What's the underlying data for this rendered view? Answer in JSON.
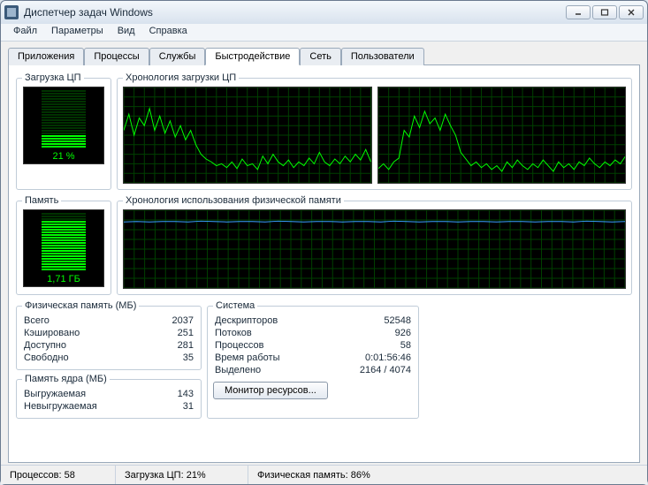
{
  "window": {
    "title": "Диспетчер задач Windows"
  },
  "menu": {
    "file": "Файл",
    "options": "Параметры",
    "view": "Вид",
    "help": "Справка"
  },
  "tabs": {
    "applications": "Приложения",
    "processes": "Процессы",
    "services": "Службы",
    "performance": "Быстродействие",
    "networking": "Сеть",
    "users": "Пользователи"
  },
  "perf": {
    "cpu_group": "Загрузка ЦП",
    "cpu_history_group": "Хронология загрузки ЦП",
    "mem_group": "Память",
    "mem_history_group": "Хронология использования физической памяти",
    "cpu_value": "21 %",
    "mem_value": "1,71 ГБ"
  },
  "phys_mem": {
    "title": "Физическая память (МБ)",
    "total_k": "Всего",
    "total_v": "2037",
    "cached_k": "Кэшировано",
    "cached_v": "251",
    "avail_k": "Доступно",
    "avail_v": "281",
    "free_k": "Свободно",
    "free_v": "35"
  },
  "kernel_mem": {
    "title": "Память ядра (МБ)",
    "paged_k": "Выгружаемая",
    "paged_v": "143",
    "nonpaged_k": "Невыгружаемая",
    "nonpaged_v": "31"
  },
  "system": {
    "title": "Система",
    "handles_k": "Дескрипторов",
    "handles_v": "52548",
    "threads_k": "Потоков",
    "threads_v": "926",
    "procs_k": "Процессов",
    "procs_v": "58",
    "uptime_k": "Время работы",
    "uptime_v": "0:01:56:46",
    "commit_k": "Выделено",
    "commit_v": "2164 / 4074"
  },
  "buttons": {
    "resmon": "Монитор ресурсов..."
  },
  "status": {
    "procs": "Процессов: 58",
    "cpu": "Загрузка ЦП: 21%",
    "mem": "Физическая память: 86%"
  },
  "chart_data": [
    {
      "type": "line",
      "title": "Хронология загрузки ЦП (ядро 1)",
      "x": "time",
      "xlabel": "",
      "ylabel": "%",
      "ylim": [
        0,
        100
      ],
      "values": [
        55,
        72,
        50,
        68,
        60,
        78,
        55,
        70,
        52,
        65,
        48,
        60,
        45,
        55,
        40,
        30,
        25,
        22,
        18,
        20,
        16,
        22,
        15,
        25,
        18,
        20,
        14,
        28,
        20,
        30,
        22,
        18,
        24,
        16,
        22,
        18,
        26,
        20,
        32,
        22,
        18,
        25,
        20,
        28,
        22,
        30,
        24,
        35,
        22
      ]
    },
    {
      "type": "line",
      "title": "Хронология загрузки ЦП (ядро 2)",
      "x": "time",
      "xlabel": "",
      "ylabel": "%",
      "ylim": [
        0,
        100
      ],
      "values": [
        15,
        20,
        14,
        22,
        26,
        55,
        48,
        70,
        58,
        75,
        62,
        68,
        55,
        72,
        60,
        50,
        32,
        25,
        18,
        22,
        16,
        20,
        14,
        18,
        12,
        22,
        16,
        24,
        18,
        14,
        20,
        16,
        24,
        18,
        12,
        22,
        16,
        20,
        14,
        22,
        18,
        26,
        20,
        16,
        22,
        18,
        24,
        20,
        28
      ]
    },
    {
      "type": "line",
      "title": "Хронология использования физической памяти",
      "x": "time",
      "xlabel": "",
      "ylabel": "ГБ",
      "ylim": [
        0,
        2.0
      ],
      "values": [
        1.7,
        1.71,
        1.7,
        1.71,
        1.71,
        1.7,
        1.72,
        1.71,
        1.7,
        1.71,
        1.71,
        1.7,
        1.72,
        1.71,
        1.7,
        1.71,
        1.71,
        1.7,
        1.71,
        1.71,
        1.7,
        1.72,
        1.71,
        1.7,
        1.71,
        1.71,
        1.7,
        1.71,
        1.71,
        1.7,
        1.71,
        1.71,
        1.7,
        1.71,
        1.71,
        1.7,
        1.72,
        1.71,
        1.7,
        1.71
      ]
    }
  ]
}
